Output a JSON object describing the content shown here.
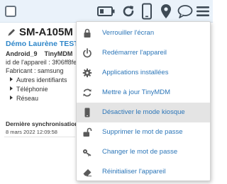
{
  "toolbar": {
    "icons": [
      "battery-icon",
      "refresh-icon",
      "phone-icon",
      "location-pin-icon",
      "chat-icon",
      "menu-icon"
    ]
  },
  "device": {
    "model": "SM-A105M",
    "owner": "Démo Laurène TEST",
    "os": "Android_9",
    "app": "TinyMDM",
    "id_line": "id de l'appareil : 3f06ff8fe4",
    "manufacturer": "Fabricant : samsung",
    "tree": [
      "Autres identifiants",
      "Téléphonie",
      "Réseau"
    ],
    "sync_label": "Dernière synchronisation",
    "sync_date": "8 mars 2022 12:09:58"
  },
  "menu": {
    "items": [
      {
        "label": "Verrouiller l'écran",
        "icon": "lock-icon"
      },
      {
        "label": "Redémarrer l'appareil",
        "icon": "power-icon"
      },
      {
        "label": "Applications installées",
        "icon": "gear-icon"
      },
      {
        "label": "Mettre à jour TinyMDM",
        "icon": "refresh-icon"
      },
      {
        "label": "Désactiver le mode kiosque",
        "icon": "phone-icon",
        "active": true
      },
      {
        "label": "Supprimer le mot de passe",
        "icon": "unlock-icon"
      },
      {
        "label": "Changer le mot de passe",
        "icon": "key-icon"
      },
      {
        "label": "Réinitialiser l'appareil",
        "icon": "eraser-icon"
      }
    ]
  },
  "colors": {
    "accent": "#2c76b8",
    "owner": "#2e86c9",
    "topbar": "#eaf2fa",
    "active_row": "#e4e4e4"
  }
}
